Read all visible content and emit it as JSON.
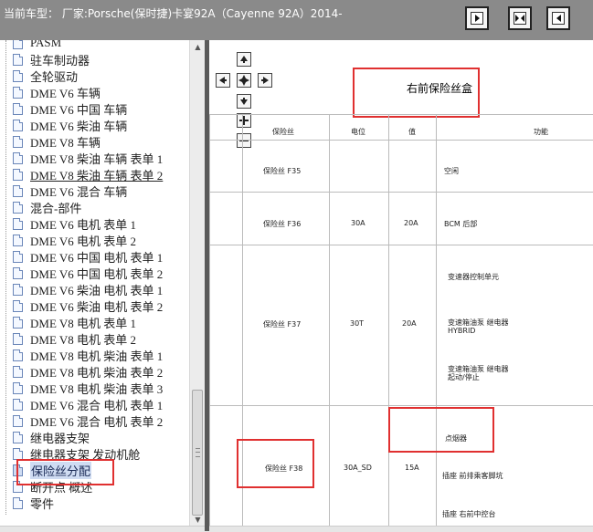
{
  "title": {
    "text": "当前车型：  厂家:Porsche(保时捷)卡宴92A（Cayenne 92A）2014-"
  },
  "tree": {
    "items": [
      {
        "label": "PASM",
        "style": "normal"
      },
      {
        "label": "驻车制动器",
        "style": "normal"
      },
      {
        "label": "全轮驱动",
        "style": "normal"
      },
      {
        "label": "DME V6 车辆",
        "style": "normal"
      },
      {
        "label": "DME V6 中国 车辆",
        "style": "normal"
      },
      {
        "label": "DME V6 柴油 车辆",
        "style": "normal"
      },
      {
        "label": "DME V8 车辆",
        "style": "normal"
      },
      {
        "label": "DME V8 柴油 车辆 表单 1",
        "style": "normal"
      },
      {
        "label": "DME V8 柴油 车辆 表单 2",
        "style": "underline"
      },
      {
        "label": "DME V6 混合 车辆",
        "style": "normal"
      },
      {
        "label": "混合-部件",
        "style": "normal"
      },
      {
        "label": "DME V6 电机 表单 1",
        "style": "normal"
      },
      {
        "label": "DME V6 电机 表单 2",
        "style": "normal"
      },
      {
        "label": "DME V6 中国 电机 表单 1",
        "style": "normal"
      },
      {
        "label": "DME V6 中国 电机 表单 2",
        "style": "normal"
      },
      {
        "label": "DME V6 柴油 电机 表单 1",
        "style": "normal"
      },
      {
        "label": "DME V6 柴油 电机 表单 2",
        "style": "normal"
      },
      {
        "label": "DME V8 电机 表单 1",
        "style": "normal"
      },
      {
        "label": "DME V8 电机 表单 2",
        "style": "normal"
      },
      {
        "label": "DME V8 电机 柴油 表单 1",
        "style": "normal"
      },
      {
        "label": "DME V8 电机 柴油 表单 2",
        "style": "normal"
      },
      {
        "label": "DME V8 电机 柴油 表单 3",
        "style": "normal"
      },
      {
        "label": "DME V6 混合 电机 表单 1",
        "style": "normal"
      },
      {
        "label": "DME V6 混合 电机 表单 2",
        "style": "normal"
      },
      {
        "label": "继电器支架",
        "style": "normal"
      },
      {
        "label": "继电器支架 发动机舱",
        "style": "normal"
      },
      {
        "label": "保险丝分配",
        "style": "selected"
      },
      {
        "label": "断开点 概述",
        "style": "normal"
      },
      {
        "label": "零件",
        "style": "normal"
      }
    ]
  },
  "diagram": {
    "title": "右前保险丝盒",
    "headers": {
      "fuse": "保险丝",
      "potential": "电位",
      "value": "值",
      "function": "功能"
    },
    "rows": [
      {
        "fuse": "保险丝 F35",
        "potential": "",
        "value": "",
        "functions": [
          "空闲"
        ]
      },
      {
        "fuse": "保险丝 F36",
        "potential": "30A",
        "value": "20A",
        "functions": [
          "BCM 后部"
        ]
      },
      {
        "fuse": "保险丝 F37",
        "potential": "30T",
        "value": "20A",
        "functions": [
          "变速器控制单元",
          "变速箱油泵 继电器\nHYBRID",
          "变速箱油泵 继电器\n起动/停止"
        ]
      },
      {
        "fuse": "保险丝 F38",
        "potential": "30A_SD",
        "value": "15A",
        "functions": [
          "点烟器",
          "插座 前排乘客脚坑",
          "插座 右前中控台"
        ]
      }
    ]
  },
  "colors": {
    "highlight": "#e03030",
    "titlebar": "#8a8a8a",
    "selection": "#cfdcf2"
  },
  "icons": {
    "toolbar": [
      "single-page-icon",
      "dual-page-icon",
      "end-page-icon"
    ],
    "nav": [
      "pan-up-icon",
      "pan-left-icon",
      "pan-center-icon",
      "pan-right-icon",
      "pan-down-icon",
      "zoom-in-icon",
      "zoom-out-icon"
    ]
  }
}
